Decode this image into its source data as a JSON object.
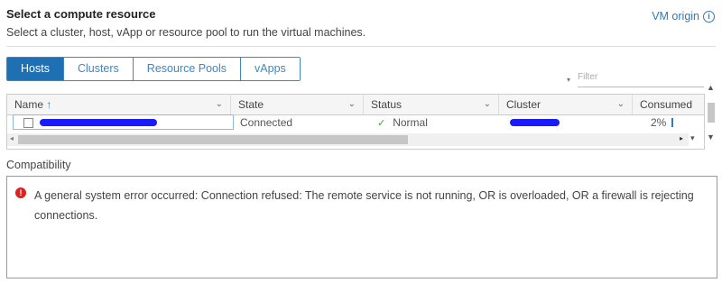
{
  "header": {
    "title": "Select a compute resource",
    "subtitle": "Select a cluster, host, vApp or resource pool to run the virtual machines.",
    "origin_label": "VM origin",
    "info_icon": "ⓘ"
  },
  "tabs": [
    {
      "label": "Hosts",
      "active": true
    },
    {
      "label": "Clusters",
      "active": false
    },
    {
      "label": "Resource Pools",
      "active": false
    },
    {
      "label": "vApps",
      "active": false
    }
  ],
  "filter": {
    "placeholder": "Filter"
  },
  "grid": {
    "columns": [
      "Name",
      "State",
      "Status",
      "Cluster",
      "Consumed"
    ],
    "sort_arrow": "↑",
    "rows": [
      {
        "name": "",
        "state": "Connected",
        "status": "Normal",
        "cluster": "",
        "consumed": "2%"
      }
    ]
  },
  "compatibility": {
    "label": "Compatibility",
    "message": "A general system error occurred: Connection refused: The remote service is not running, OR is overloaded, OR a firewall is rejecting connections."
  },
  "colors": {
    "accent": "#1f6fb3",
    "error": "#dd2222",
    "ok": "#3c9a3c",
    "redaction": "#1a1aff"
  }
}
